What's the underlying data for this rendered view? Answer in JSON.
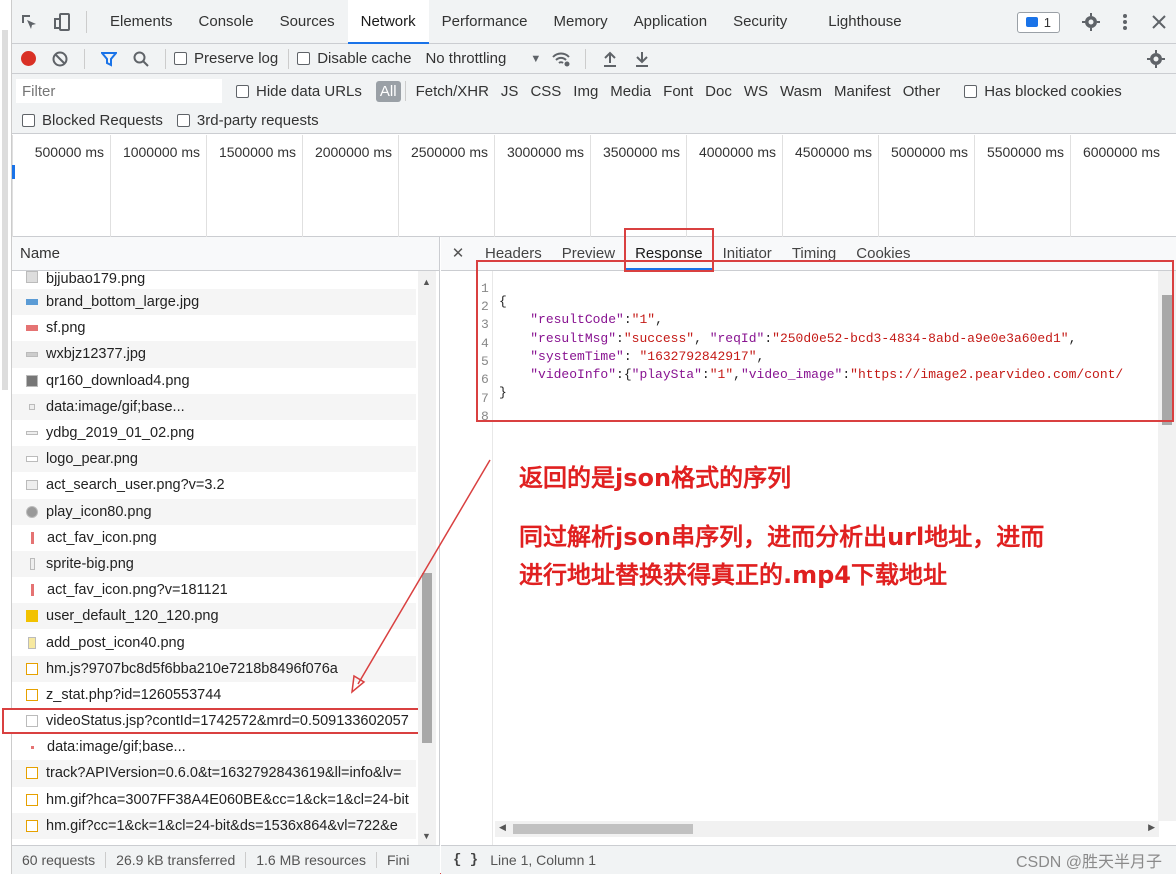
{
  "tabs": [
    "Elements",
    "Console",
    "Sources",
    "Network",
    "Performance",
    "Memory",
    "Application",
    "Security",
    "Lighthouse"
  ],
  "active_tab": "Network",
  "issues_count": "1",
  "toolbar": {
    "preserve_log": "Preserve log",
    "disable_cache": "Disable cache",
    "throttling": "No throttling"
  },
  "filter": {
    "placeholder": "Filter",
    "hide_data_urls": "Hide data URLs",
    "types": [
      "All",
      "Fetch/XHR",
      "JS",
      "CSS",
      "Img",
      "Media",
      "Font",
      "Doc",
      "WS",
      "Wasm",
      "Manifest",
      "Other"
    ],
    "has_blocked_cookies": "Has blocked cookies",
    "blocked_requests": "Blocked Requests",
    "third_party": "3rd-party requests"
  },
  "timeline": [
    "500000 ms",
    "1000000 ms",
    "1500000 ms",
    "2000000 ms",
    "2500000 ms",
    "3000000 ms",
    "3500000 ms",
    "4000000 ms",
    "4500000 ms",
    "5000000 ms",
    "5500000 ms",
    "6000000 ms"
  ],
  "name_header": "Name",
  "requests": [
    "bjjubao179.png",
    "brand_bottom_large.jpg",
    "sf.png",
    "wxbjz12377.jpg",
    "qr160_download4.png",
    "data:image/gif;base...",
    "ydbg_2019_01_02.png",
    "logo_pear.png",
    "act_search_user.png?v=3.2",
    "play_icon80.png",
    "act_fav_icon.png",
    "sprite-big.png",
    "act_fav_icon.png?v=181121",
    "user_default_120_120.png",
    "add_post_icon40.png",
    "hm.js?9707bc8d5f6bba210e7218b8496f076a",
    "z_stat.php?id=1260553744",
    "videoStatus.jsp?contId=1742572&mrd=0.509133602057",
    "data:image/gif;base...",
    "track?APIVersion=0.6.0&t=1632792843619&ll=info&lv=",
    "hm.gif?hca=3007FF38A4E060BE&cc=1&ck=1&cl=24-bit",
    "hm.gif?cc=1&ck=1&cl=24-bit&ds=1536x864&vl=722&e"
  ],
  "detail_tabs": [
    "Headers",
    "Preview",
    "Response",
    "Initiator",
    "Timing",
    "Cookies"
  ],
  "active_detail_tab": "Response",
  "response_lines": [
    "1",
    "2",
    "3",
    "4",
    "5",
    "6",
    "7",
    "8"
  ],
  "response": {
    "resultCode": "1",
    "resultMsg": "success",
    "reqId": "250d0e52-bcd3-4834-8abd-a9e0e3a60ed1",
    "systemTime": "1632792842917",
    "playSta": "1",
    "video_image_prefix": "https://image2.pearvideo.com/cont/"
  },
  "annotation": {
    "line1": "返回的是json格式的序列",
    "line2": "同过解析json串序列，进而分析出url地址，进而",
    "line3": "进行地址替换获得真正的.mp4下载地址"
  },
  "status": {
    "requests": "60 requests",
    "transferred": "26.9 kB transferred",
    "resources": "1.6 MB resources",
    "finish": "Fini"
  },
  "cursor_position": "Line 1, Column 1",
  "watermark": "CSDN @胜天半月子"
}
